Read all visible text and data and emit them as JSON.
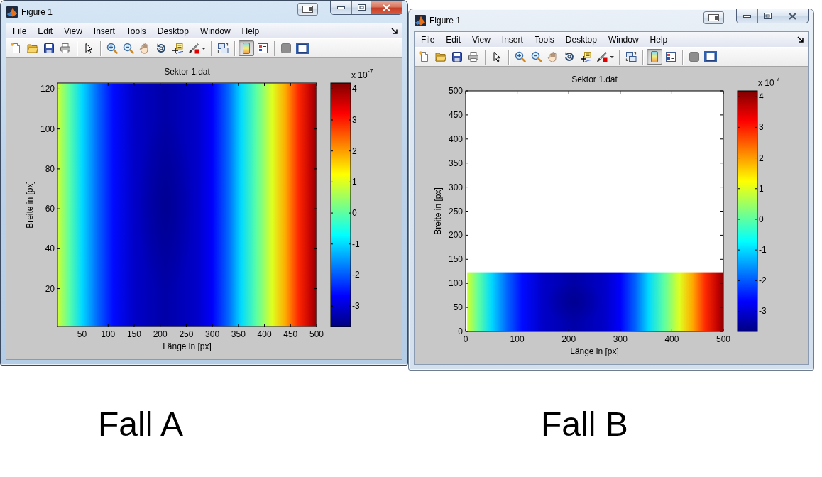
{
  "panels": [
    {
      "window": {
        "title": "Figure 1",
        "active": true,
        "menu": [
          "File",
          "Edit",
          "View",
          "Insert",
          "Tools",
          "Desktop",
          "Window",
          "Help"
        ],
        "toolbar": [
          [
            {
              "kind": "button",
              "pressed": false
            },
            {
              "kind": "button",
              "pressed": false
            },
            {
              "kind": "button",
              "pressed": false
            },
            {
              "kind": "button",
              "pressed": false
            }
          ],
          [
            {
              "kind": "button",
              "pressed": false
            }
          ],
          [
            {
              "kind": "button",
              "pressed": false
            },
            {
              "kind": "button",
              "pressed": false
            },
            {
              "kind": "button",
              "pressed": false
            },
            {
              "kind": "button",
              "pressed": false
            },
            {
              "kind": "button",
              "pressed": false
            },
            {
              "kind": "split",
              "pressed": false
            }
          ],
          [
            {
              "kind": "button",
              "pressed": false
            }
          ],
          [
            {
              "kind": "button",
              "pressed": true
            },
            {
              "kind": "button",
              "pressed": false
            }
          ],
          [
            {
              "kind": "button",
              "pressed": false
            },
            {
              "kind": "button",
              "pressed": false
            }
          ]
        ],
        "figure": {
          "title": "Sektor 1.dat",
          "xlabel": "Länge in [px]",
          "ylabel": "Breite in [px]",
          "xticks": [
            "50",
            "100",
            "150",
            "200",
            "250",
            "300",
            "350",
            "400",
            "450",
            "500"
          ],
          "yticks": [
            "120",
            "100",
            "80",
            "60",
            "40",
            "20"
          ],
          "colorbar": {
            "multiplier": "x 10$^{-7}$",
            "ticks": [
              "4",
              "3",
              "2",
              "1",
              "0",
              "-1",
              "-2",
              "-3"
            ]
          }
        }
      },
      "caption": "Fall A"
    },
    {
      "window": {
        "title": "Figure 1",
        "active": false,
        "menu": [
          "File",
          "Edit",
          "View",
          "Insert",
          "Tools",
          "Desktop",
          "Window",
          "Help"
        ],
        "toolbar": [
          [
            {
              "kind": "button",
              "pressed": false
            },
            {
              "kind": "button",
              "pressed": false
            },
            {
              "kind": "button",
              "pressed": false
            },
            {
              "kind": "button",
              "pressed": false
            }
          ],
          [
            {
              "kind": "button",
              "pressed": false
            }
          ],
          [
            {
              "kind": "button",
              "pressed": false
            },
            {
              "kind": "button",
              "pressed": false
            },
            {
              "kind": "button",
              "pressed": false
            },
            {
              "kind": "button",
              "pressed": false
            },
            {
              "kind": "button",
              "pressed": false
            },
            {
              "kind": "split",
              "pressed": false
            }
          ],
          [
            {
              "kind": "button",
              "pressed": false
            }
          ],
          [
            {
              "kind": "button",
              "pressed": true
            },
            {
              "kind": "button",
              "pressed": false
            }
          ],
          [
            {
              "kind": "button",
              "pressed": false
            },
            {
              "kind": "button",
              "pressed": false
            }
          ]
        ],
        "figure": {
          "title": "Sektor 1.dat",
          "xlabel": "Länge in [px]",
          "ylabel": "Breite in [px]",
          "xticks": [
            "0",
            "100",
            "200",
            "300",
            "400",
            "500"
          ],
          "yticks": [
            "500",
            "450",
            "400",
            "350",
            "300",
            "250",
            "200",
            "150",
            "100",
            "50",
            "0"
          ],
          "colorbar": {
            "multiplier": "x 10$^{-7}$",
            "ticks": [
              "4",
              "3",
              "2",
              "1",
              "0",
              "-1",
              "-2",
              "-3"
            ]
          }
        }
      },
      "caption": "Fall B"
    }
  ]
}
